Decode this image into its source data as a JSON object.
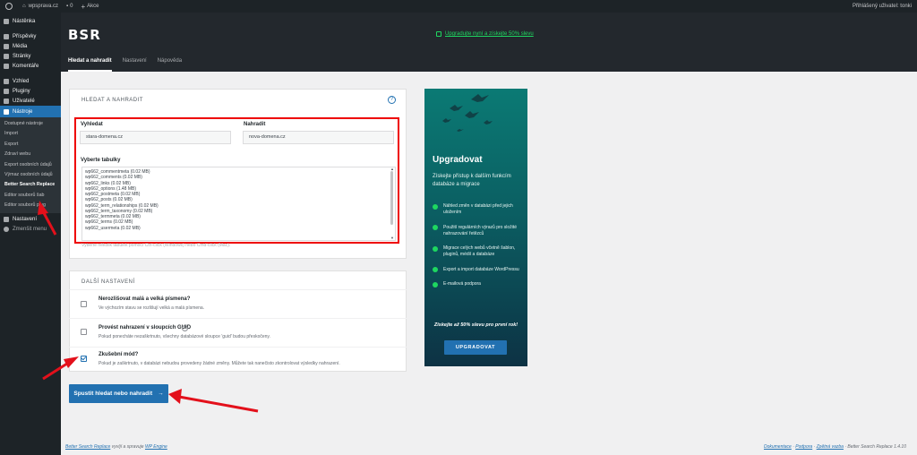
{
  "adminbar": {
    "site_name": "wpsprava.cz",
    "comments_count": "0",
    "new_label": "Akce",
    "greeting": "Přihlášený uživatel: tonki"
  },
  "sidebar": {
    "items": [
      {
        "label": "Nástěnka"
      },
      {
        "label": "Příspěvky"
      },
      {
        "label": "Média"
      },
      {
        "label": "Stránky"
      },
      {
        "label": "Komentáře"
      },
      {
        "label": "Vzhled"
      },
      {
        "label": "Pluginy"
      },
      {
        "label": "Uživatelé"
      },
      {
        "label": "Nástroje"
      }
    ],
    "submenu": [
      {
        "label": "Dostupné nástroje"
      },
      {
        "label": "Import"
      },
      {
        "label": "Export"
      },
      {
        "label": "Zdraví webu"
      },
      {
        "label": "Export osobních údajů"
      },
      {
        "label": "Výmaz osobních údajů"
      },
      {
        "label": "Better Search Replace"
      },
      {
        "label": "Editor souborů šab"
      },
      {
        "label": "Editor souborů plug"
      }
    ],
    "after": [
      {
        "label": "Nastavení"
      },
      {
        "label": "Zmenšit menu"
      }
    ]
  },
  "header": {
    "logo": "BSR",
    "upgrade_link": "Upgradujte nyní a získejte 50% slevu",
    "tabs": [
      "Hledat a nahradit",
      "Nastavení",
      "Nápověda"
    ]
  },
  "search_card": {
    "title": "Hledat a nahradit",
    "help": "?",
    "search_label": "Vyhledat",
    "search_value": "stara-domena.cz",
    "replace_label": "Nahradit",
    "replace_value": "nova-domena.cz",
    "tables_label": "Vyberte tabulky",
    "tables": [
      "wp662_commentmeta (0.02 MB)",
      "wp662_comments (0.02 MB)",
      "wp662_links (0.02 MB)",
      "wp662_options (1.48 MB)",
      "wp662_postmeta (0.02 MB)",
      "wp662_posts (0.02 MB)",
      "wp662_term_relationships (0.02 MB)",
      "wp662_term_taxonomy (0.02 MB)",
      "wp662_termmeta (0.02 MB)",
      "wp662_terms (0.02 MB)",
      "wp662_usermeta (0.02 MB)"
    ],
    "tables_hint": "Vyberte několik tabulek pomocí Ctrl-click (Windows) nebo Cmd-click (Mac)."
  },
  "settings_card": {
    "title": "Další nastavení",
    "options": [
      {
        "title": "Nerozlišovat malá a velká písmena?",
        "desc": "Ve výchozím stavu se rozlišují velká a malá písmena.",
        "checked": false
      },
      {
        "title": "Provést nahrazení v sloupcích GUID",
        "desc": "Pokud ponecháte nezaškrtnuto, všechny databázové sloupce 'guid' budou přeskočeny.",
        "checked": false
      },
      {
        "title": "Zkušební mód?",
        "desc": "Pokud je zaškrtnuto, v databázi nebudou provedeny žádné změny. Můžete tak nanečisto zkontrolovat výsledky nahrazení.",
        "checked": true
      }
    ]
  },
  "run_button": "Spustit hledat nebo nahradit",
  "promo": {
    "title": "Upgradovat",
    "subtitle": "Získejte přístup k dalším funkcím databáze a migrace",
    "features": [
      "Náhled změn v databázi před jejich uložením",
      "Použití regulárních výrazů pro složité nahrazování řetězců",
      "Migrace celých webů včetně šablon, pluginů, médií a databáze",
      "Export a import databáze WordPressu",
      "E-mailová podpora"
    ],
    "offer": "Získejte až 50% slevu pro první rok!",
    "button": "UPGRADOVAT",
    "accent": "#1ed760"
  },
  "footer": {
    "left_link": "Better Search Replace",
    "left_text": "vyvíjí a spravuje",
    "left_link2": "WP Engine",
    "right_links": [
      "Dokumentace",
      "Podpora",
      "Zpětná vazba"
    ],
    "version": "Better Search Replace 1.4.10"
  }
}
